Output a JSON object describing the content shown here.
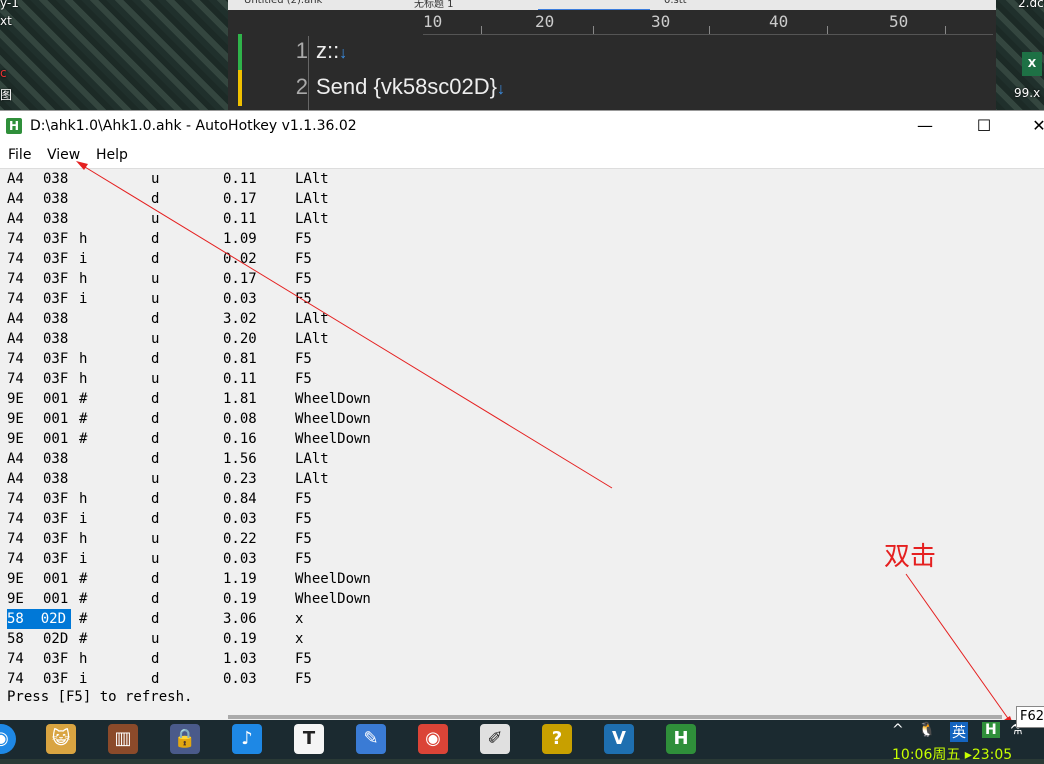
{
  "desktop": {
    "label_top_left_1": "ý-1",
    "label_top_left_2": "xt",
    "label_top_left_3": "c",
    "label_top_left_4": "图",
    "label_right_1": "2.dc",
    "label_right_2": "99.x"
  },
  "editor": {
    "tabs": [
      "Untitled (2).ahk",
      "无标题 1",
      "",
      "0.stt"
    ],
    "ruler_marks": [
      "10",
      "20",
      "30",
      "40",
      "50"
    ],
    "lines": [
      {
        "number": "1",
        "code": "z::",
        "marker_color": "#2fb34a"
      },
      {
        "number": "2",
        "code": "Send {vk58sc02D}",
        "marker_color": "#f0c000"
      }
    ],
    "line_end_arrow": "↓"
  },
  "window": {
    "title": "D:\\ahk1.0\\Ahk1.0.ahk - AutoHotkey v1.1.36.02",
    "app_icon": "H",
    "controls": {
      "minimize": "—",
      "maximize": "☐",
      "close": "✕"
    }
  },
  "menu": {
    "file": "File",
    "view": "View",
    "help": "Help"
  },
  "key_history": {
    "rows": [
      {
        "vk": "A4",
        "sc": "038",
        "type": "",
        "updown": "u",
        "elapsed": "0.11",
        "key": "LAlt"
      },
      {
        "vk": "A4",
        "sc": "038",
        "type": "",
        "updown": "d",
        "elapsed": "0.17",
        "key": "LAlt"
      },
      {
        "vk": "A4",
        "sc": "038",
        "type": "",
        "updown": "u",
        "elapsed": "0.11",
        "key": "LAlt"
      },
      {
        "vk": "74",
        "sc": "03F",
        "type": "h",
        "updown": "d",
        "elapsed": "1.09",
        "key": "F5"
      },
      {
        "vk": "74",
        "sc": "03F",
        "type": "i",
        "updown": "d",
        "elapsed": "0.02",
        "key": "F5"
      },
      {
        "vk": "74",
        "sc": "03F",
        "type": "h",
        "updown": "u",
        "elapsed": "0.17",
        "key": "F5"
      },
      {
        "vk": "74",
        "sc": "03F",
        "type": "i",
        "updown": "u",
        "elapsed": "0.03",
        "key": "F5"
      },
      {
        "vk": "A4",
        "sc": "038",
        "type": "",
        "updown": "d",
        "elapsed": "3.02",
        "key": "LAlt"
      },
      {
        "vk": "A4",
        "sc": "038",
        "type": "",
        "updown": "u",
        "elapsed": "0.20",
        "key": "LAlt"
      },
      {
        "vk": "74",
        "sc": "03F",
        "type": "h",
        "updown": "d",
        "elapsed": "0.81",
        "key": "F5"
      },
      {
        "vk": "74",
        "sc": "03F",
        "type": "h",
        "updown": "u",
        "elapsed": "0.11",
        "key": "F5"
      },
      {
        "vk": "9E",
        "sc": "001",
        "type": "#",
        "updown": "d",
        "elapsed": "1.81",
        "key": "WheelDown"
      },
      {
        "vk": "9E",
        "sc": "001",
        "type": "#",
        "updown": "d",
        "elapsed": "0.08",
        "key": "WheelDown"
      },
      {
        "vk": "9E",
        "sc": "001",
        "type": "#",
        "updown": "d",
        "elapsed": "0.16",
        "key": "WheelDown"
      },
      {
        "vk": "A4",
        "sc": "038",
        "type": "",
        "updown": "d",
        "elapsed": "1.56",
        "key": "LAlt"
      },
      {
        "vk": "A4",
        "sc": "038",
        "type": "",
        "updown": "u",
        "elapsed": "0.23",
        "key": "LAlt"
      },
      {
        "vk": "74",
        "sc": "03F",
        "type": "h",
        "updown": "d",
        "elapsed": "0.84",
        "key": "F5"
      },
      {
        "vk": "74",
        "sc": "03F",
        "type": "i",
        "updown": "d",
        "elapsed": "0.03",
        "key": "F5"
      },
      {
        "vk": "74",
        "sc": "03F",
        "type": "h",
        "updown": "u",
        "elapsed": "0.22",
        "key": "F5"
      },
      {
        "vk": "74",
        "sc": "03F",
        "type": "i",
        "updown": "u",
        "elapsed": "0.03",
        "key": "F5"
      },
      {
        "vk": "9E",
        "sc": "001",
        "type": "#",
        "updown": "d",
        "elapsed": "1.19",
        "key": "WheelDown"
      },
      {
        "vk": "9E",
        "sc": "001",
        "type": "#",
        "updown": "d",
        "elapsed": "0.19",
        "key": "WheelDown"
      },
      {
        "vk": "58",
        "sc": "02D",
        "type": "#",
        "updown": "d",
        "elapsed": "3.06",
        "key": "x",
        "selected": true
      },
      {
        "vk": "58",
        "sc": "02D",
        "type": "#",
        "updown": "u",
        "elapsed": "0.19",
        "key": "x"
      },
      {
        "vk": "74",
        "sc": "03F",
        "type": "h",
        "updown": "d",
        "elapsed": "1.03",
        "key": "F5"
      },
      {
        "vk": "74",
        "sc": "03F",
        "type": "i",
        "updown": "d",
        "elapsed": "0.03",
        "key": "F5"
      }
    ],
    "status": "Press [F5] to refresh."
  },
  "annotation": {
    "text": "双击",
    "color": "#e52020"
  },
  "taskbar": {
    "icons": [
      {
        "name": "cat-app-icon",
        "glyph": "😺",
        "bg": "#d9a441"
      },
      {
        "name": "books-app-icon",
        "glyph": "▥",
        "bg": "#8b4a2a"
      },
      {
        "name": "lock-app-icon",
        "glyph": "🔒",
        "bg": "#4a5a8a"
      },
      {
        "name": "music-app-icon",
        "glyph": "♪",
        "bg": "#1e88e5"
      },
      {
        "name": "typora-app-icon",
        "glyph": "T",
        "bg": "#f5f5f5"
      },
      {
        "name": "paint-app-icon",
        "glyph": "✎",
        "bg": "#3a7bd5"
      },
      {
        "name": "chrome-icon",
        "glyph": "◉",
        "bg": "#db4437"
      },
      {
        "name": "notepad-app-icon",
        "glyph": "✐",
        "bg": "#e0e0e0"
      },
      {
        "name": "help-doc-app-icon",
        "glyph": "?",
        "bg": "#c8a000"
      },
      {
        "name": "vim-app-icon",
        "glyph": "V",
        "bg": "#1e6fb0"
      },
      {
        "name": "autohotkey-taskbar-icon",
        "glyph": "H",
        "bg": "#2f8f3a"
      }
    ],
    "tray": {
      "chevron": "^",
      "ime": "英",
      "ahk": "H"
    },
    "clock": "10:06周五 ▸23:05",
    "tooltip": "F62"
  }
}
